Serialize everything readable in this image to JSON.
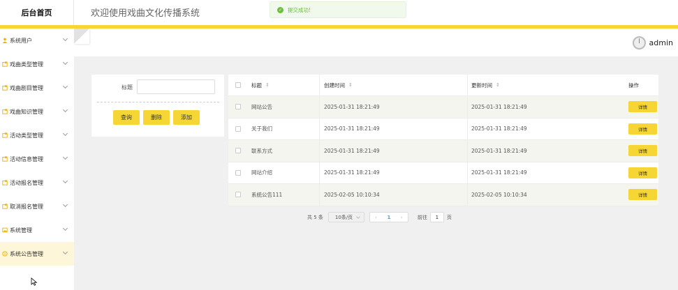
{
  "brand": "后台首页",
  "system_title": "欢迎使用戏曲文化传播系统",
  "toast": {
    "message": "提交成功!"
  },
  "user": {
    "name": "admin"
  },
  "sidebar": {
    "items": [
      {
        "label": "系统用户",
        "icon": "user-icon",
        "icon_color": "#f0b400"
      },
      {
        "label": "戏曲类型管理",
        "icon": "folder-icon",
        "icon_color": "#f0b400"
      },
      {
        "label": "戏曲剧目管理",
        "icon": "folder-icon",
        "icon_color": "#f0b400"
      },
      {
        "label": "戏曲知识管理",
        "icon": "folder-icon",
        "icon_color": "#f0b400"
      },
      {
        "label": "活动类型管理",
        "icon": "folder-icon",
        "icon_color": "#f0b400"
      },
      {
        "label": "活动信息管理",
        "icon": "folder-icon",
        "icon_color": "#f0b400"
      },
      {
        "label": "活动报名管理",
        "icon": "folder-icon",
        "icon_color": "#f0b400"
      },
      {
        "label": "取消报名管理",
        "icon": "folder-icon",
        "icon_color": "#f0b400"
      },
      {
        "label": "系统管理",
        "icon": "picture-icon",
        "icon_color": "#f0b400"
      },
      {
        "label": "系统公告管理",
        "icon": "info-circle-icon",
        "icon_color": "#f0b400",
        "active": true
      }
    ]
  },
  "search": {
    "title_label": "标题",
    "title_value": "",
    "query_label": "查询",
    "delete_label": "删除",
    "add_label": "添加"
  },
  "table": {
    "headers": {
      "title": "标题",
      "created": "创建时间",
      "updated": "更新时间",
      "actions": "操作"
    },
    "rows": [
      {
        "title": "网站公告",
        "created": "2025-01-31 18:21:49",
        "updated": "2025-01-31 18:21:49",
        "action": "详情"
      },
      {
        "title": "关于我们",
        "created": "2025-01-31 18:21:49",
        "updated": "2025-01-31 18:21:49",
        "action": "详情"
      },
      {
        "title": "联系方式",
        "created": "2025-01-31 18:21:49",
        "updated": "2025-01-31 18:21:49",
        "action": "详情"
      },
      {
        "title": "网站介绍",
        "created": "2025-01-31 18:21:49",
        "updated": "2025-01-31 18:21:49",
        "action": "详情"
      },
      {
        "title": "系统公告111",
        "created": "2025-02-05 10:10:34",
        "updated": "2025-02-05 10:10:34",
        "action": "详情"
      }
    ]
  },
  "pagination": {
    "total_text": "共 5 条",
    "page_size": "10条/页",
    "current_page": "1",
    "goto_label": "前往",
    "goto_value": "1",
    "page_suffix": "页"
  },
  "colors": {
    "accent": "#f5d634",
    "success": "#67c23a",
    "active_bg": "#fdf6d8"
  }
}
